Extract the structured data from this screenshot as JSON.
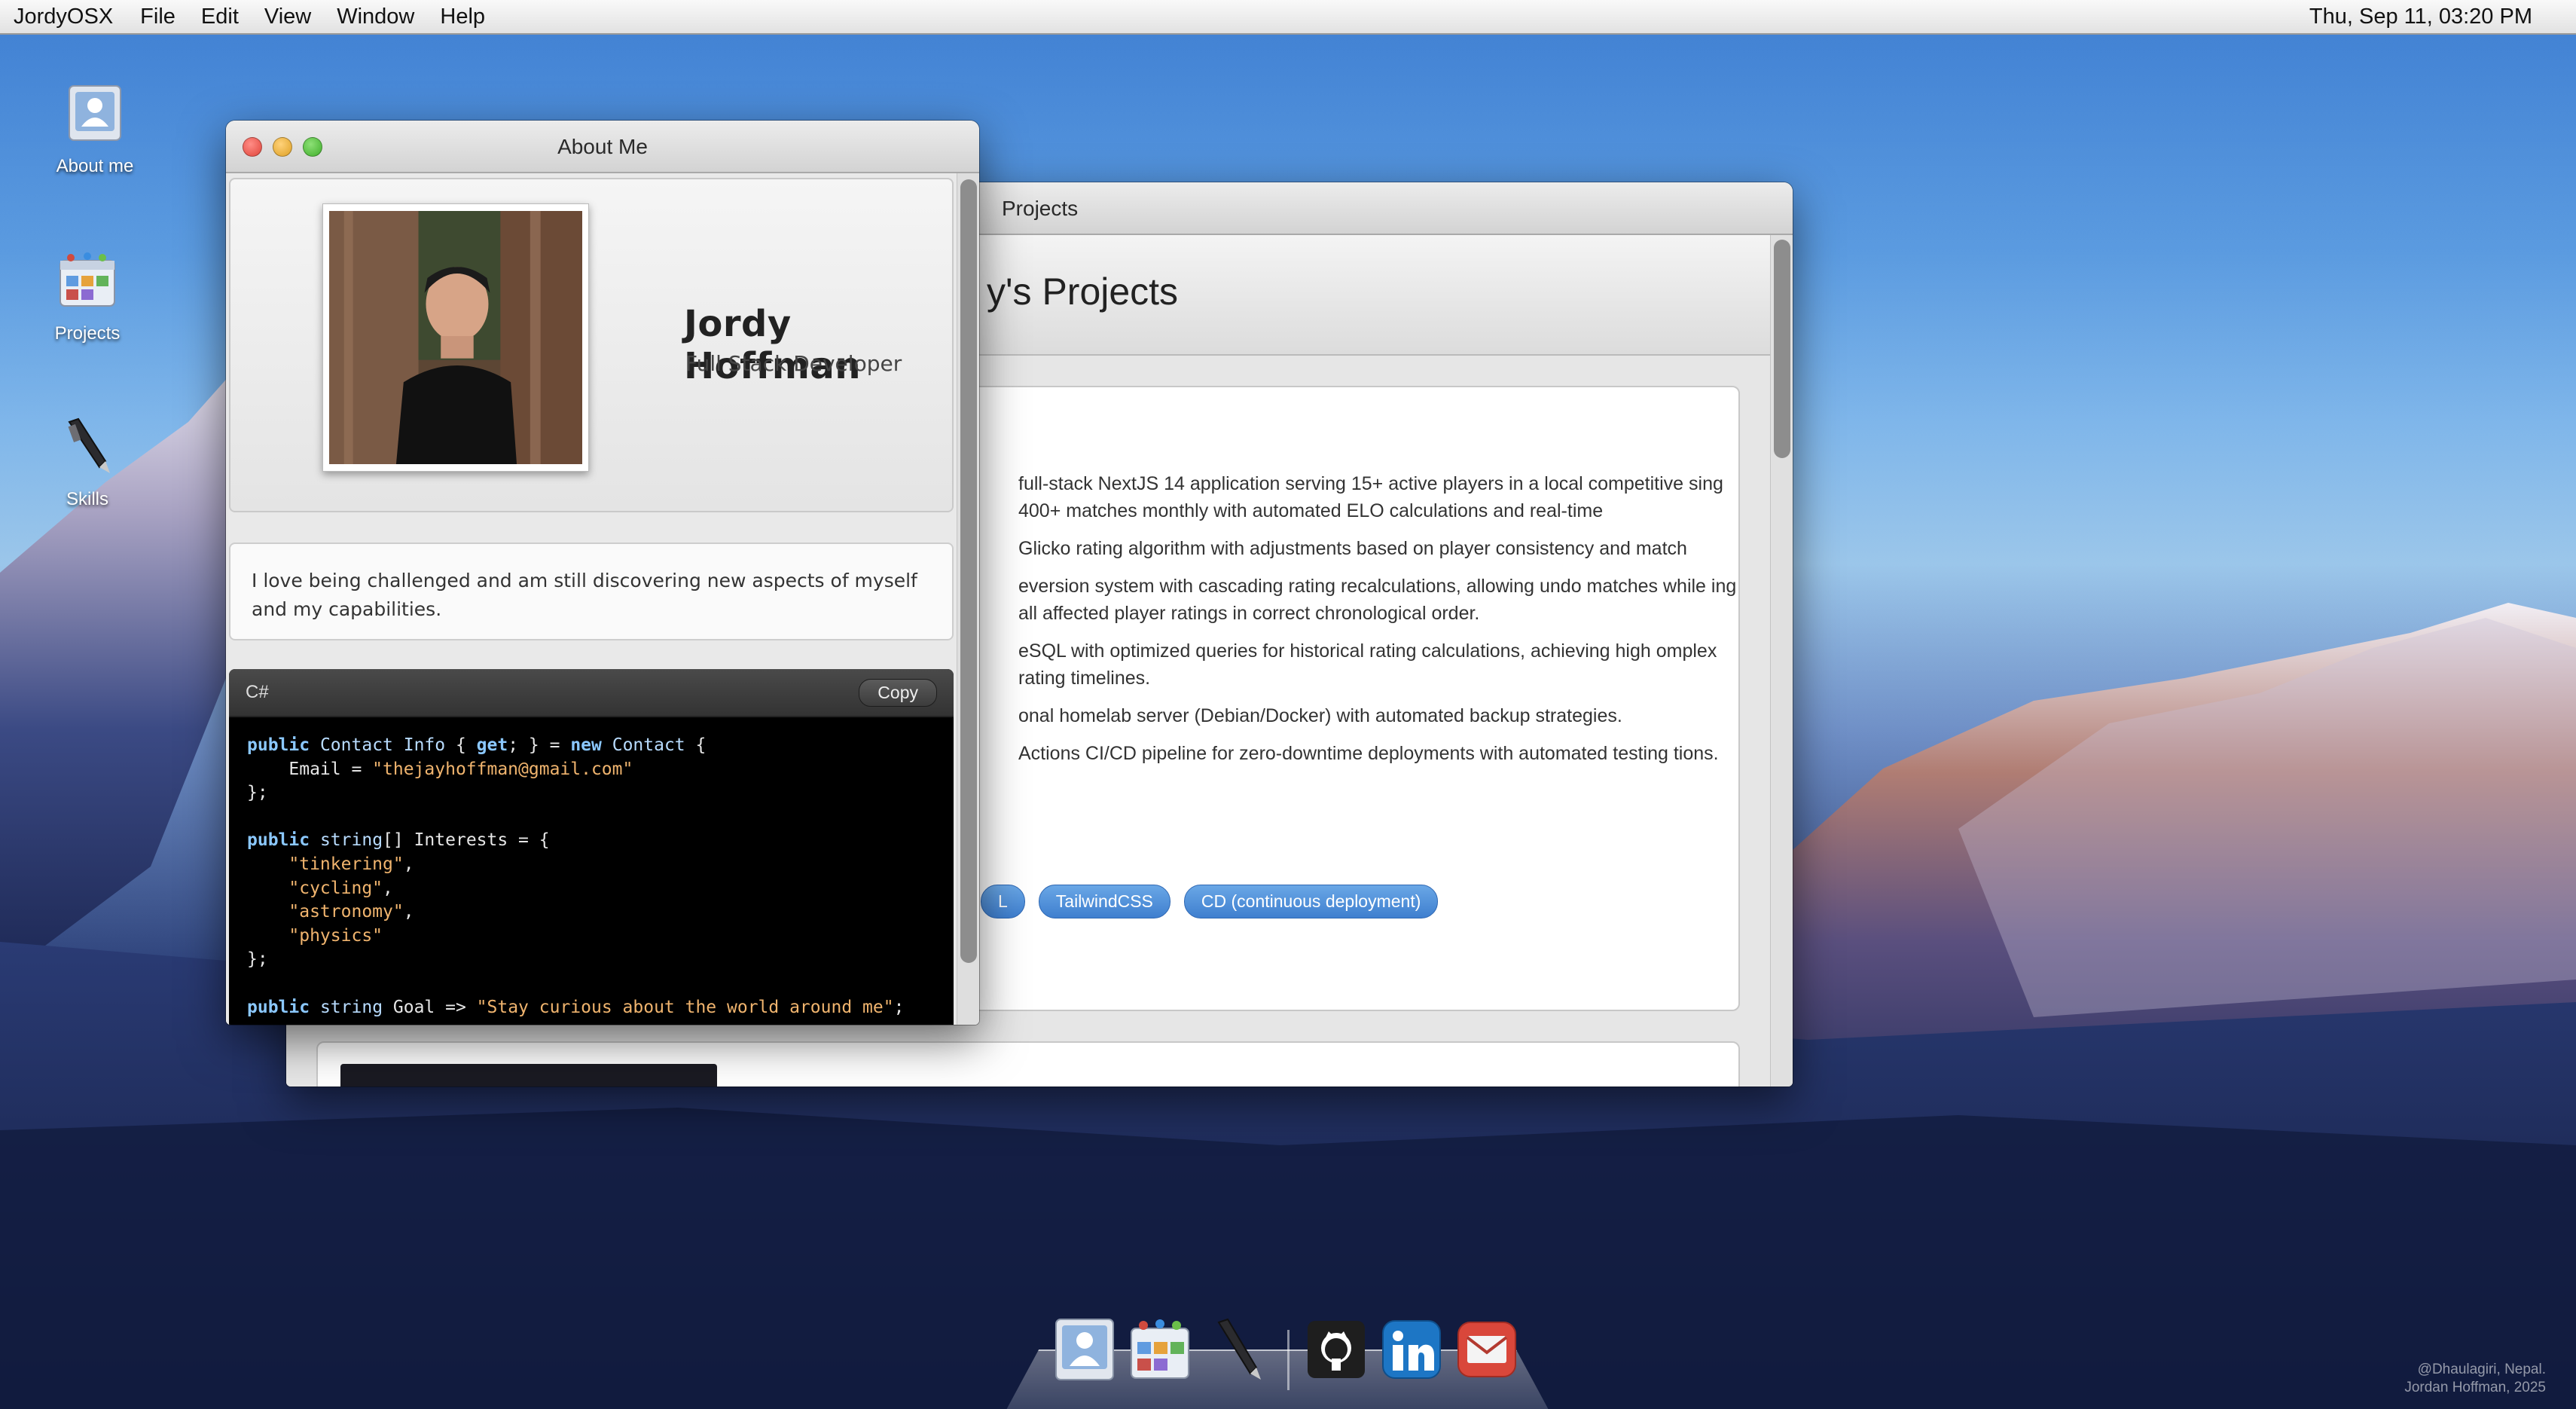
{
  "menubar": {
    "app_name": "JordyOSX",
    "menus": [
      "File",
      "Edit",
      "View",
      "Window",
      "Help"
    ],
    "clock": "Thu, Sep 11, 03:20 PM"
  },
  "desktop_icons": [
    {
      "label": "About me",
      "icon": "user-card-icon"
    },
    {
      "label": "Projects",
      "icon": "calendar-board-icon"
    },
    {
      "label": "Skills",
      "icon": "pen-tool-icon"
    }
  ],
  "about_window": {
    "title": "About Me",
    "name": "Jordy Hoffman",
    "role": "Full Stack Developer",
    "bio": "I love being challenged and am still discovering new aspects of myself and my capabilities.",
    "code_language": "C#",
    "copy_label": "Copy",
    "code": {
      "email": "\"thejayhoffman@gmail.com\"",
      "interests": [
        "\"tinkering\"",
        "\"cycling\"",
        "\"astronomy\"",
        "\"physics\""
      ],
      "goal": "\"Stay curious about the world around me\""
    }
  },
  "projects_window": {
    "title": "Projects",
    "heading": "y's Projects",
    "bullets": [
      "full-stack NextJS 14 application serving 15+ active players in a local competitive sing 400+ matches monthly with automated ELO calculations and real-time",
      "Glicko rating algorithm with adjustments based on player consistency and match",
      "eversion system with cascading rating recalculations, allowing undo matches while ing all affected player ratings in correct chronological order.",
      "eSQL with optimized queries for historical rating calculations, achieving high omplex rating timelines.",
      "onal homelab server (Debian/Docker) with automated backup strategies.",
      "Actions CI/CD pipeline for zero-downtime deployments with automated testing tions."
    ],
    "tags": [
      "L",
      "TailwindCSS",
      "CD (continuous deployment)"
    ]
  },
  "dock": {
    "items": [
      "about-me-icon",
      "projects-icon",
      "skills-icon",
      "github-icon",
      "linkedin-icon",
      "mail-icon"
    ]
  },
  "credit": {
    "line1": "@Dhaulagiri, Nepal.",
    "line2": "Jordan Hoffman, 2025"
  },
  "colors": {
    "tag_blue": "#3f7fcf",
    "code_bg": "#000000",
    "keyword": "#8bc8ff",
    "string": "#f0b46e"
  }
}
